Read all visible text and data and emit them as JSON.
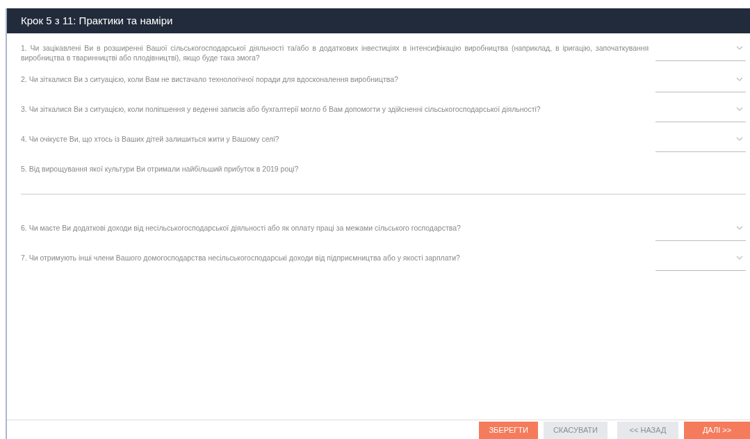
{
  "header": {
    "title": "Крок 5 з 11: Практики та наміри"
  },
  "questions": [
    {
      "kind": "select",
      "text": "1. Чи зацікавлені Ви в розширенні Вашої сільськогосподарської діяльності та/або в додаткових інвестиціях в інтенсифікацію виробництва (наприклад, в іригацію, започаткування виробництва в тваринництві або плодівництві), якщо буде така змога?"
    },
    {
      "kind": "select",
      "text": "2. Чи зіткалися Ви з ситуацією, коли Вам не вистачало технологічної поради для вдосконалення виробництва?"
    },
    {
      "kind": "select",
      "text": "3. Чи зіткалися Ви з ситуацією, коли поліпшення у веденні записів або бухгалтерії могло б Вам допомогти у здійсненні сільськогосподарської діяльності?"
    },
    {
      "kind": "select",
      "text": "4. Чи очікуєте Ви, що хтось із Ваших дітей залишиться жити у Вашому селі?"
    },
    {
      "kind": "text",
      "text": "5. Від вирощування якої культури Ви отримали найбільший прибуток в 2019 році?"
    },
    {
      "kind": "select",
      "text": "6. Чи маєте Ви додаткові доходи від несільськогосподарської діяльності або як оплату праці за межами сільського господарства?"
    },
    {
      "kind": "select",
      "text": "7. Чи отримують інші члени Вашого домогосподарства несільськогосподарські доходи від підприємництва або у якості зарплати?"
    }
  ],
  "buttons": [
    {
      "kind": "primary",
      "label": "ЗБЕРЕГТИ"
    },
    {
      "kind": "secondary",
      "label": "СКАСУВАТИ"
    },
    {
      "kind": "secondary",
      "label": "<< НАЗАД"
    },
    {
      "kind": "primary",
      "label": "ДАЛІ >>"
    }
  ]
}
